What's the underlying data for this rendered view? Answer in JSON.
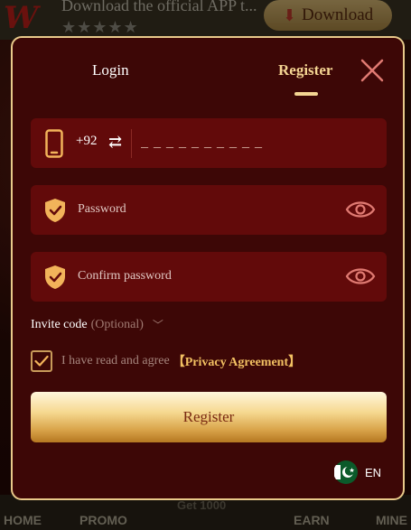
{
  "background": {
    "banner": {
      "title": "Download the official APP t...",
      "stars": "★★★★★",
      "download_label": "Download"
    },
    "bottom_nav": {
      "home": "HOME",
      "promo": "PROMO",
      "get_coin": "Get 1000",
      "earn": "EARN",
      "mine": "MINE"
    }
  },
  "modal": {
    "tabs": {
      "login": "Login",
      "register": "Register",
      "active": "register"
    },
    "phone": {
      "country_code": "+92",
      "swap_glyph": "⇄",
      "placeholder": "_ _ _ _ _ _ _ _ _ _"
    },
    "password": {
      "placeholder": "Password"
    },
    "confirm_password": {
      "placeholder": "Confirm password"
    },
    "invite": {
      "label": "Invite code",
      "optional": "(Optional)"
    },
    "agreement": {
      "checked": true,
      "text": "I have read and agree",
      "link": "【Privacy Agreement】"
    },
    "register_button": "Register",
    "language": {
      "code": "EN"
    }
  },
  "colors": {
    "accent_gold": "#f5d593",
    "field_bg": "#620a0a",
    "modal_bg": "#3d0706"
  }
}
